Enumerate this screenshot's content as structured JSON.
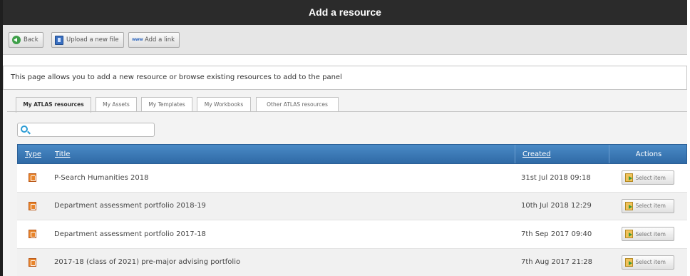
{
  "window": {
    "title": "Add a resource"
  },
  "toolbar": {
    "back_label": "Back",
    "upload_label": "Upload a new file",
    "link_label": "Add a link",
    "link_icon_text": "www"
  },
  "intro": "This page allows you to add a new resource or browse existing resources to add to the panel",
  "tabs": [
    {
      "label": "My ATLAS resources",
      "active": true
    },
    {
      "label": "My Assets"
    },
    {
      "label": "My Templates"
    },
    {
      "label": "My Workbooks"
    },
    {
      "label": "Other ATLAS resources"
    }
  ],
  "search": {
    "value": "",
    "placeholder": ""
  },
  "table": {
    "headers": {
      "type": "Type",
      "title": "Title",
      "created": "Created",
      "actions": "Actions"
    },
    "rows": [
      {
        "title": "P-Search Humanities 2018",
        "created": "31st Jul 2018 09:18",
        "action": "Select item"
      },
      {
        "title": "Department assessment portfolio 2018-19",
        "created": "10th Jul 2018 12:29",
        "action": "Select item"
      },
      {
        "title": "Department assessment portfolio 2017-18",
        "created": "7th Sep 2017 09:40",
        "action": "Select item"
      },
      {
        "title": "2017-18 (class of 2021) pre-major advising portfolio",
        "created": "7th Aug 2017 21:28",
        "action": "Select item"
      }
    ]
  },
  "colors": {
    "titlebar": "#2b2b2b",
    "header": "#3a7ab8",
    "accent": "#2a9bd4"
  }
}
